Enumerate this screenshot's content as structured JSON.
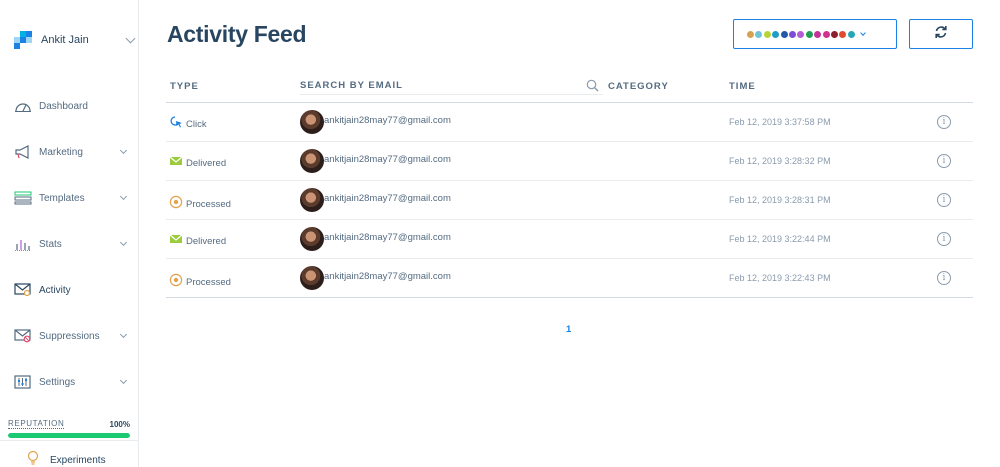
{
  "sidebar": {
    "account_name": "Ankit Jain",
    "items": [
      {
        "label": "Dashboard",
        "icon": "dashboard-icon"
      },
      {
        "label": "Marketing",
        "icon": "megaphone-icon"
      },
      {
        "label": "Templates",
        "icon": "templates-icon"
      },
      {
        "label": "Stats",
        "icon": "stats-icon"
      },
      {
        "label": "Activity",
        "icon": "activity-icon"
      },
      {
        "label": "Suppressions",
        "icon": "suppressions-icon"
      },
      {
        "label": "Settings",
        "icon": "settings-icon"
      }
    ],
    "reputation": {
      "label": "REPUTATION",
      "value": "100%",
      "fraction": 1.0
    },
    "experiments_label": "Experiments"
  },
  "header": {
    "title": "Activity Feed"
  },
  "filter_colors": [
    "#d5a253",
    "#6fc3d6",
    "#b8d335",
    "#1f9ec9",
    "#2457a7",
    "#7b4dd6",
    "#b25cd6",
    "#1e9f55",
    "#c4319a",
    "#d2318f",
    "#8a1f2d",
    "#e04a2d",
    "#25a7b6"
  ],
  "table": {
    "columns": {
      "type": "TYPE",
      "search_placeholder": "SEARCH BY EMAIL",
      "category": "CATEGORY",
      "time": "TIME"
    },
    "rows": [
      {
        "type": "Click",
        "type_icon": "click-icon",
        "email": "ankitjain28may77@gmail.com",
        "time": "Feb 12, 2019 3:37:58 PM"
      },
      {
        "type": "Delivered",
        "type_icon": "delivered-icon",
        "email": "ankitjain28may77@gmail.com",
        "time": "Feb 12, 2019 3:28:32 PM"
      },
      {
        "type": "Processed",
        "type_icon": "processed-icon",
        "email": "ankitjain28may77@gmail.com",
        "time": "Feb 12, 2019 3:28:31 PM"
      },
      {
        "type": "Delivered",
        "type_icon": "delivered-icon",
        "email": "ankitjain28may77@gmail.com",
        "time": "Feb 12, 2019 3:22:44 PM"
      },
      {
        "type": "Processed",
        "type_icon": "processed-icon",
        "email": "ankitjain28may77@gmail.com",
        "time": "Feb 12, 2019 3:22:43 PM"
      }
    ]
  },
  "pagination": {
    "current_page": "1"
  },
  "colors": {
    "primary": "#1a82e2",
    "text": "#294661",
    "reputation_green": "#1ac972",
    "delivered_green": "#9ccc3d",
    "processed_orange": "#e3a34c"
  }
}
